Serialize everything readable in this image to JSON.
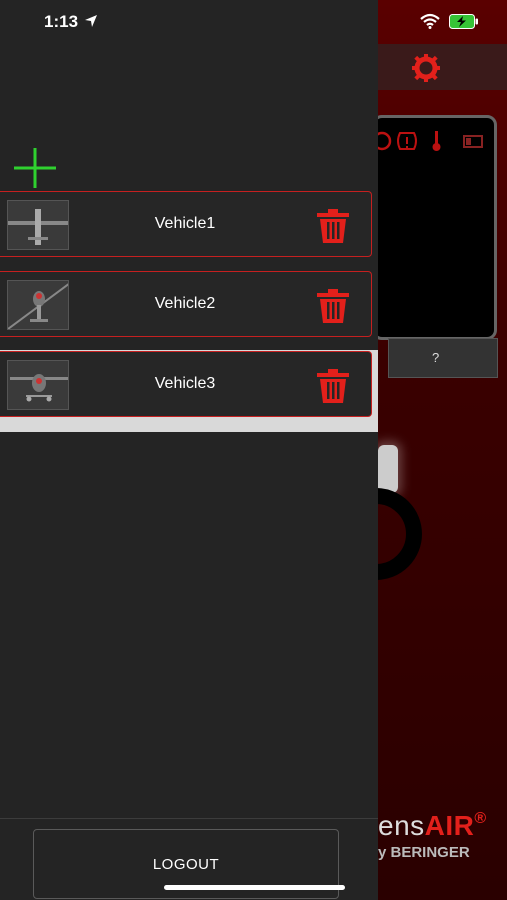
{
  "status_bar": {
    "time": "1:13"
  },
  "drawer": {
    "vehicles": [
      {
        "name": "Vehicle1",
        "thumbnail": "airplane-top-view"
      },
      {
        "name": "Vehicle2",
        "thumbnail": "helicopter-front-view"
      },
      {
        "name": "Vehicle3",
        "thumbnail": "airplane-front-view"
      }
    ],
    "logout_label": "LOGOUT"
  },
  "background_app": {
    "help_label": "?",
    "brand_main_prefix": "ens",
    "brand_main_accent": "AIR",
    "brand_reg": "®",
    "brand_sub": "y BERINGER"
  },
  "colors": {
    "accent_red": "#e2201b",
    "add_green": "#2fd12f",
    "drawer_bg": "#242424"
  },
  "icons": {
    "add": "plus-icon",
    "delete": "trash-icon",
    "settings": "gear-icon",
    "wifi": "wifi-icon",
    "battery": "battery-charging-icon"
  }
}
